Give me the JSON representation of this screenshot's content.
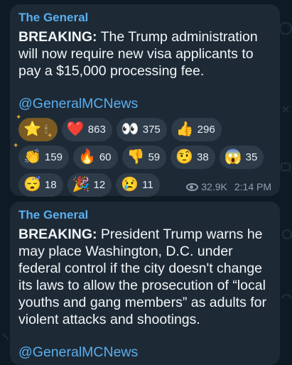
{
  "messages": [
    {
      "sender": "The General",
      "lead": "BREAKING:",
      "text": "The Trump administration will now require new visa applicants to pay a $15,000 processing fee.",
      "link": "@GeneralMCNews",
      "reactions": [
        {
          "emoji": "⭐",
          "extra": "🕯",
          "count": "",
          "active": true
        },
        {
          "emoji": "❤️",
          "count": "863"
        },
        {
          "emoji": "👀",
          "count": "375"
        },
        {
          "emoji": "👍",
          "count": "296"
        },
        {
          "emoji": "👏",
          "count": "159"
        },
        {
          "emoji": "🔥",
          "count": "60"
        },
        {
          "emoji": "👎",
          "count": "59"
        },
        {
          "emoji": "🤨",
          "count": "38"
        },
        {
          "emoji": "😱",
          "count": "35"
        },
        {
          "emoji": "😴",
          "count": "18"
        },
        {
          "emoji": "🎉",
          "count": "12"
        },
        {
          "emoji": "😢",
          "count": "11"
        }
      ],
      "views": "32.9K",
      "time": "2:14 PM"
    },
    {
      "sender": "The General",
      "lead": "BREAKING:",
      "text": "President Trump warns he may place Washington, D.C. under federal control if the city doesn't change its laws to allow the prosecution of “local youths and gang members” as adults for violent attacks and shootings.",
      "link": "@GeneralMCNews"
    }
  ]
}
